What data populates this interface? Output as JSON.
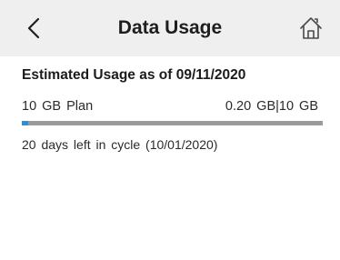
{
  "header": {
    "title": "Data Usage",
    "back_icon": "chevron-left-icon",
    "home_icon": "home-icon"
  },
  "usage": {
    "heading": "Estimated Usage as of 09/11/2020",
    "plan_label": "10 GB  Plan",
    "amount_label": "0.20  GB|10  GB",
    "used_fraction": 0.02,
    "cycle_text": "20  days  left  in  cycle  (10/01/2020)"
  },
  "colors": {
    "header_bg": "#efefef",
    "progress_fill": "#2f8fd6",
    "progress_track": "#9a9a9a"
  }
}
